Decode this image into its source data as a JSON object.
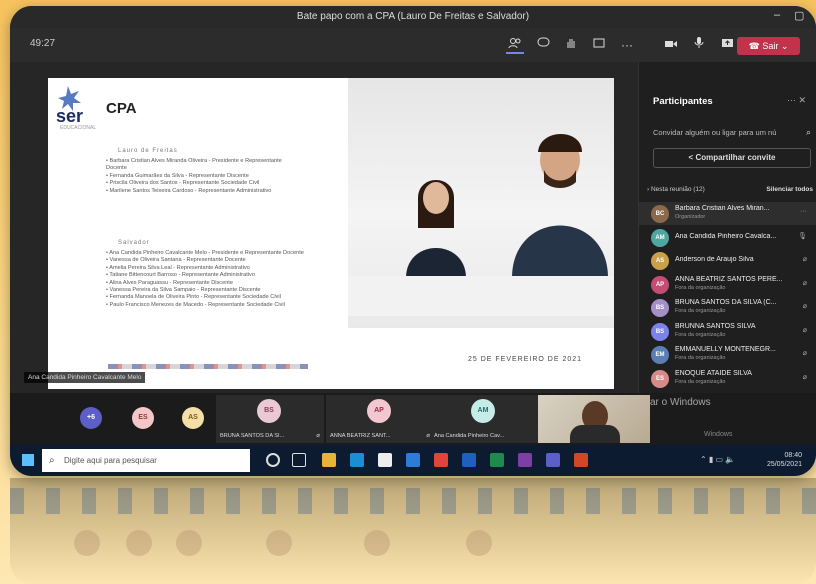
{
  "window": {
    "title": "Bate papo com a CPA (Lauro De Freitas e Salvador)",
    "minimize": "–",
    "maximize": "▢"
  },
  "toolbar": {
    "timer": "49:27",
    "leave_label": "Sair"
  },
  "slide": {
    "logo_text": "ser",
    "logo_sub": "EDUCACIONAL",
    "heading": "CPA",
    "section1": "Lauro de Freitas",
    "list1": [
      "Barbara Cristian Alves Miranda Oliveira - Presidente e Representante Docente",
      "Fernanda Guimarães da Silva - Representante Discente",
      "Priscila Oliveira dos Santos - Representante Sociedade Civil",
      "Marilene Santos Teixeira Cardoso - Representante Administrativo"
    ],
    "section2": "Salvador",
    "list2": [
      "Ana Candida Pinheiro Cavalcante Melo - Presidente e Representante Docente",
      "Vanessa de Oliveira Santana - Representante Docente",
      "Amelia Pereira Silva Leal - Representante Administrativo",
      "Tatiane Bittencourt Barroso - Representante Administrativo",
      "Alina Alves Paraguassu - Representante Discente",
      "Vanessa Pereira da Silva Sampaio - Representante Discente",
      "Fernanda Manoela de Oliveira Pinto - Representante Sociedade Civil",
      "Paulo Francisco Menezes de Macedo - Representante Sociedade Civil"
    ],
    "date": "25 DE FEVEREIRO DE 2021"
  },
  "speaker_tag": "Ana Candida Pinheiro Cavalcante Melo",
  "participants": {
    "title": "Participantes",
    "invite_placeholder": "Convidar alguém ou ligar para um nú",
    "share_label": "Compartilhar convite",
    "meeting_label": "Nesta reunião (12)",
    "mute_all": "Silenciar todos",
    "list": [
      {
        "initials": "BC",
        "name": "Barbara Cristian Alves Miran...",
        "sub": "Organizador",
        "color": "#8a6a4a"
      },
      {
        "initials": "AM",
        "name": "Ana Candida Pinheiro Cavalca...",
        "sub": "",
        "color": "#4fa6a0"
      },
      {
        "initials": "AS",
        "name": "Anderson de Araujo Silva",
        "sub": "",
        "color": "#c8a14a"
      },
      {
        "initials": "AP",
        "name": "ANNA BEATRIZ SANTOS PERE...",
        "sub": "Fora da organização",
        "color": "#c34d74"
      },
      {
        "initials": "BS",
        "name": "BRUNA SANTOS DA SILVA (C...",
        "sub": "Fora da organização",
        "color": "#a58fc7"
      },
      {
        "initials": "BS",
        "name": "BRUNNA SANTOS SILVA",
        "sub": "Fora da organização",
        "color": "#7b83eb"
      },
      {
        "initials": "EM",
        "name": "EMMANUELLY MONTENEGR...",
        "sub": "Fora da organização",
        "color": "#5b7fb5"
      },
      {
        "initials": "ES",
        "name": "ENOQUE ATAIDE SILVA",
        "sub": "Fora da organização",
        "color": "#d88a8a"
      }
    ]
  },
  "thumbs": {
    "more": "+6",
    "pills": [
      "ES",
      "AS"
    ],
    "tiles": [
      {
        "initials": "BS",
        "label": "BRUNA SANTOS DA SI..."
      },
      {
        "initials": "AP",
        "label": "ANNA BEATRIZ SANT..."
      },
      {
        "initials": "AM",
        "label": "Ana Candida Pinheiro Cav..."
      }
    ],
    "watermark": "ar o Windows",
    "watermark2": "Windows"
  },
  "taskbar": {
    "search_placeholder": "Digite aqui para pesquisar",
    "time": "08:40",
    "date": "25/05/2021"
  }
}
